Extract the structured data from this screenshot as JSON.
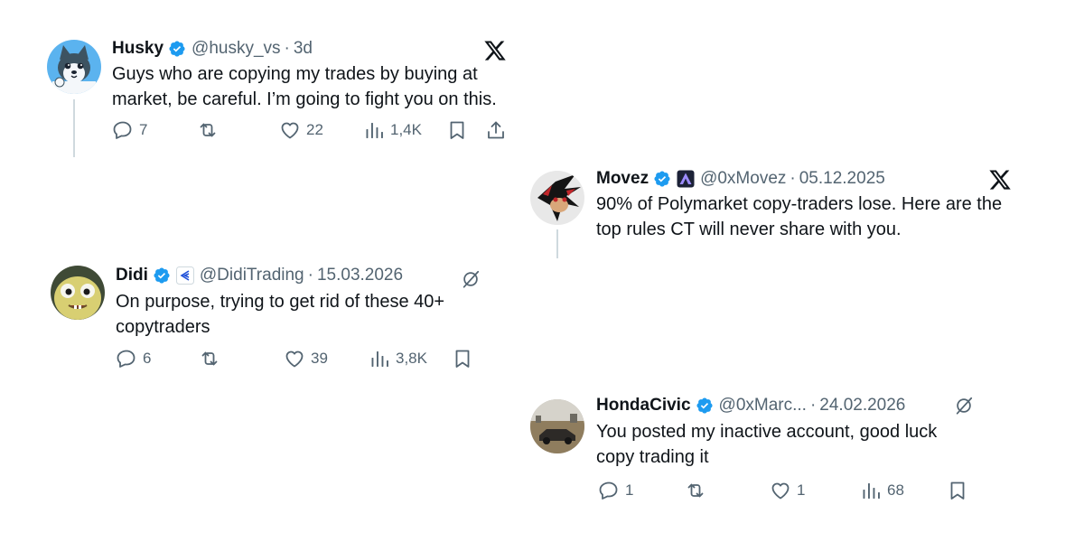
{
  "colors": {
    "verified": "#1d9bf0",
    "secondary": "#536471",
    "primary": "#0f1419",
    "line": "#cfd9de"
  },
  "posts": [
    {
      "name": "Husky",
      "handle": "@husky_vs",
      "date": "3d",
      "text": "Guys who are copying my trades by buying at market, be careful. I’m going to fight you on this.",
      "replies": "7",
      "likes": "22",
      "views": "1,4K",
      "logo": "x-logo"
    },
    {
      "name": "Movez",
      "handle": "@0xMovez",
      "date": "05.12.2025",
      "text": "90% of Polymarket copy-traders lose. Here are the top rules CT will never share with you.",
      "logo": "x-logo"
    },
    {
      "name": "Didi",
      "handle": "@DidiTrading",
      "date": "15.03.2026",
      "text": "On purpose, trying to get rid of these 40+ copytraders",
      "replies": "6",
      "likes": "39",
      "views": "3,8K",
      "logo": "grok-icon"
    },
    {
      "name": "HondaCivic",
      "handle": "@0xMarc...",
      "date": "24.02.2026",
      "text": "You posted my inactive account, good luck copy trading it",
      "replies": "1",
      "likes": "1",
      "views": "68",
      "logo": "grok-icon"
    }
  ],
  "separator": "·"
}
